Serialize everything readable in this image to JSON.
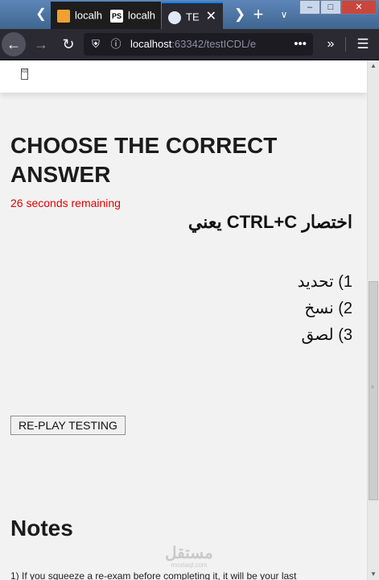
{
  "browser": {
    "tabs": [
      {
        "label": "localh",
        "favicon": "intellij-icon"
      },
      {
        "label": "localh",
        "favicon": "ps-icon",
        "favicon_text": "PS"
      },
      {
        "label": "TE",
        "favicon": "firefox-page-icon",
        "active": true
      }
    ],
    "address": {
      "host": "localhost",
      "path": ":63342/testICDL/e"
    },
    "colors": {
      "accent": "#0a84ff",
      "toolbar": "#2b2a33",
      "urlbar": "#1c1b22"
    }
  },
  "page": {
    "header_image_alt": "icdl",
    "heading": "CHOOSE THE CORRECT ANSWER",
    "timer": "26 seconds remaining",
    "question": "اختصار CTRL+C يعني",
    "answers": [
      "1) تحديد",
      "2) نسخ",
      "3) لصق"
    ],
    "replay_label": "RE-PLAY TESTING",
    "notes_heading": "Notes",
    "notes_text": "1) If you squeeze a re-exam before completing it, it will be your last",
    "watermark": {
      "main": "مستقل",
      "sub": "mostaql.com"
    },
    "colors": {
      "timer": "#e30000",
      "background": "#f2f2f2"
    }
  }
}
